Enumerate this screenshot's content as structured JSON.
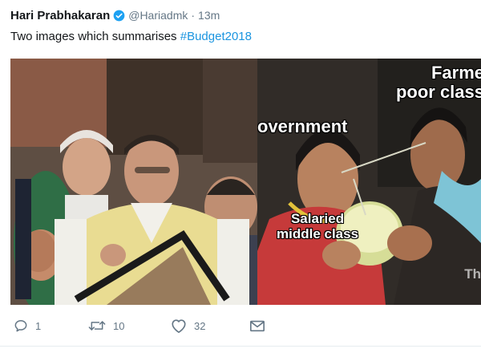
{
  "tweet": {
    "author_name": "Hari Prabhakaran",
    "handle": "@Hariadmk",
    "separator": "·",
    "time": "13m",
    "text_plain": "Two images which summarises ",
    "hashtag": "#Budget2018"
  },
  "media": {
    "labels": {
      "government": "overnment",
      "farmers_line1": "Farme",
      "farmers_line2": "poor class",
      "salaried_line1": "Salaried",
      "salaried_line2": "middle class",
      "watermark": "Th"
    }
  },
  "actions": {
    "reply_count": "1",
    "retweet_count": "10",
    "like_count": "32"
  },
  "colors": {
    "link": "#1b95e0",
    "verified": "#1da1f2",
    "muted": "#657786"
  }
}
